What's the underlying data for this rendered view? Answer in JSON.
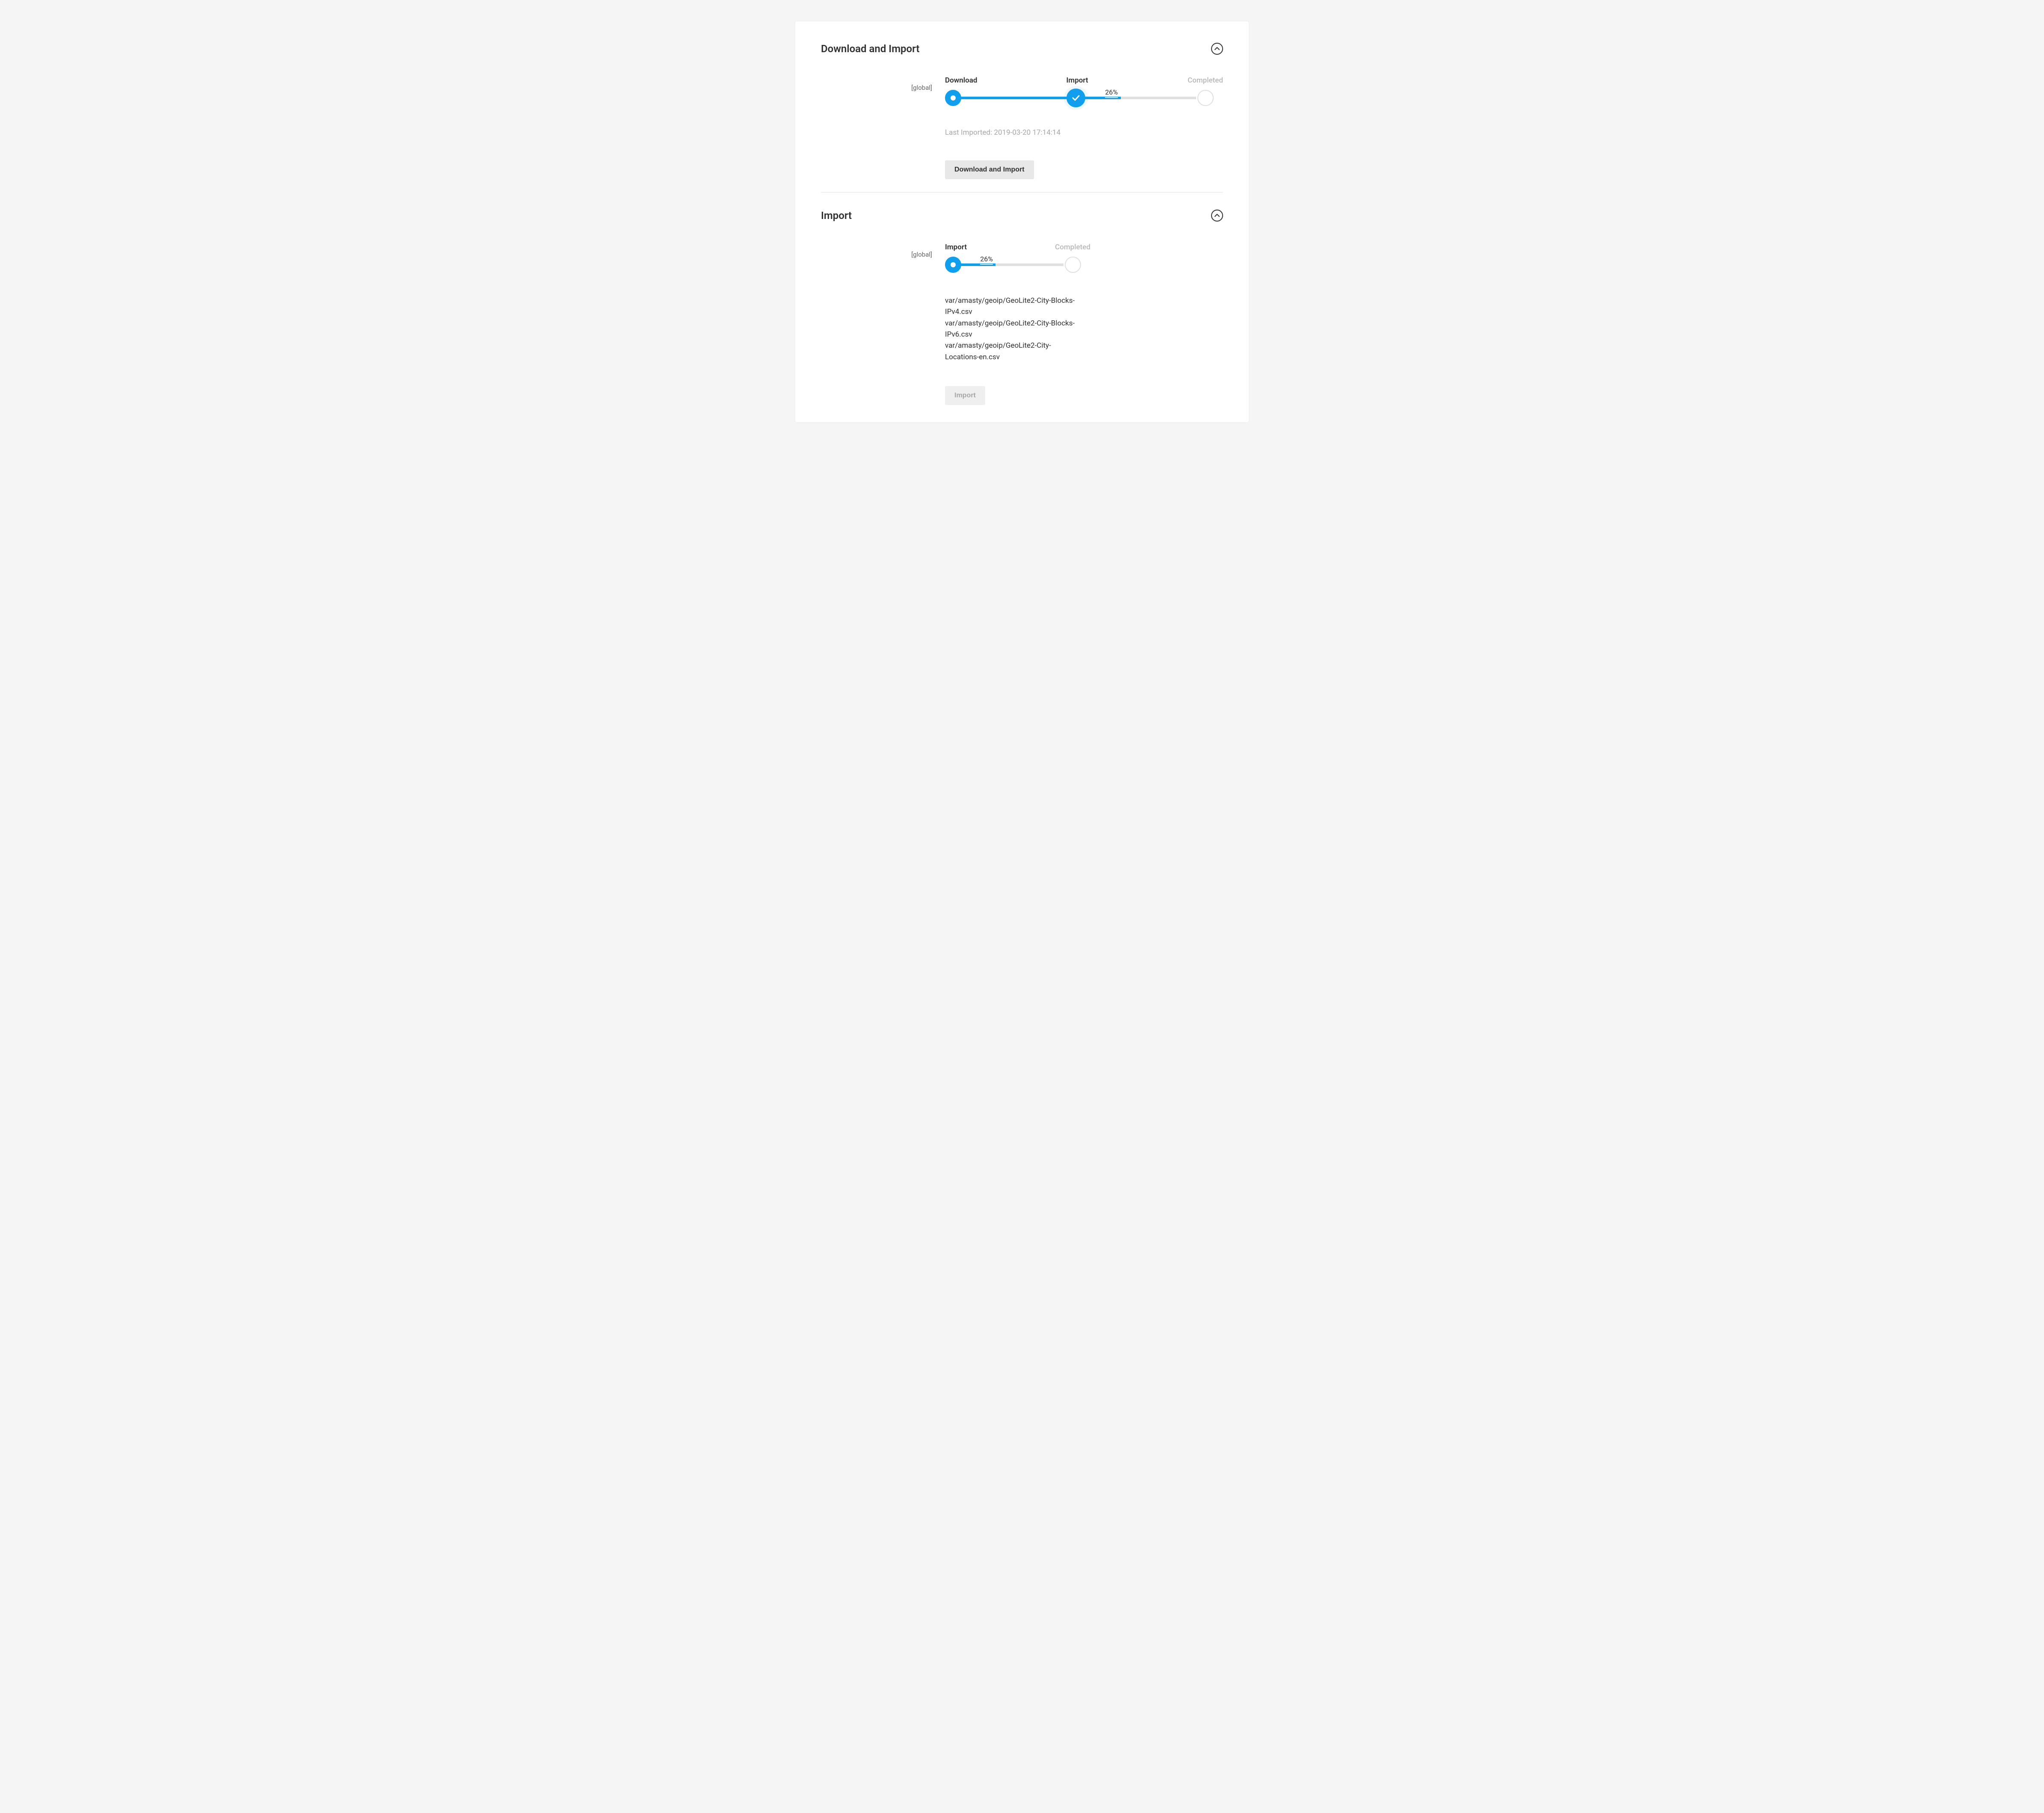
{
  "sections": {
    "download_import": {
      "title": "Download and Import",
      "scope": "[global]",
      "steps": {
        "download": "Download",
        "import": "Import",
        "completed": "Completed"
      },
      "percent": "26%",
      "last_imported_label": "Last Imported: 2019-03-20 17:14:14",
      "button": "Download and Import"
    },
    "import_only": {
      "title": "Import",
      "scope": "[global]",
      "steps": {
        "import": "Import",
        "completed": "Completed"
      },
      "percent": "26%",
      "files": [
        "var/amasty/geoip/GeoLite2-City-Blocks-IPv4.csv",
        "var/amasty/geoip/GeoLite2-City-Blocks-IPv6.csv",
        "var/amasty/geoip/GeoLite2-City-Locations-en.csv"
      ],
      "button": "Import"
    }
  },
  "colors": {
    "accent": "#119eec"
  }
}
